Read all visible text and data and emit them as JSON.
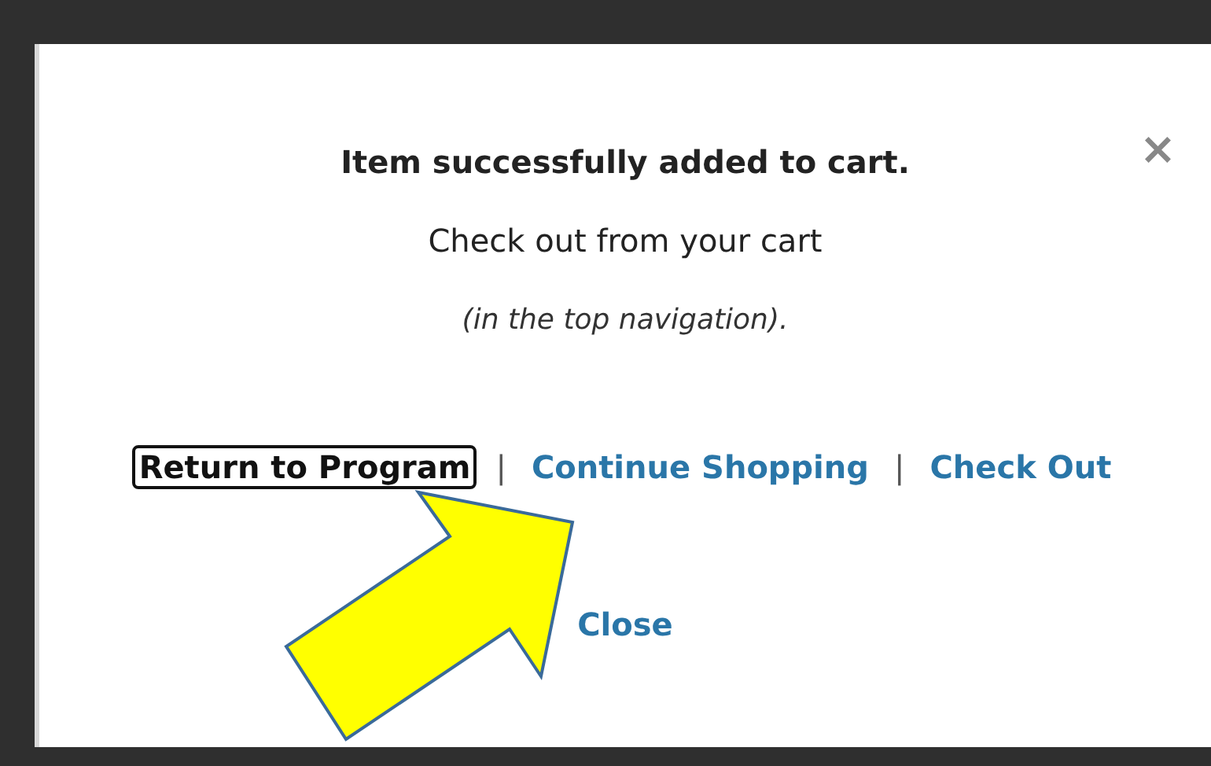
{
  "dialog": {
    "close_icon": "×",
    "title": "Item successfully added to cart.",
    "message": "Check out from your cart",
    "note": "(in the top navigation).",
    "actions": [
      {
        "kind": "link",
        "text": "Return to Program",
        "focused": true
      },
      {
        "kind": "separator",
        "text": "|"
      },
      {
        "kind": "link",
        "text": "Continue Shopping",
        "focused": false
      },
      {
        "kind": "separator",
        "text": "|"
      },
      {
        "kind": "link",
        "text": "Check Out",
        "focused": false
      }
    ],
    "close_link": "Close"
  },
  "annotation": {
    "kind": "arrow"
  }
}
